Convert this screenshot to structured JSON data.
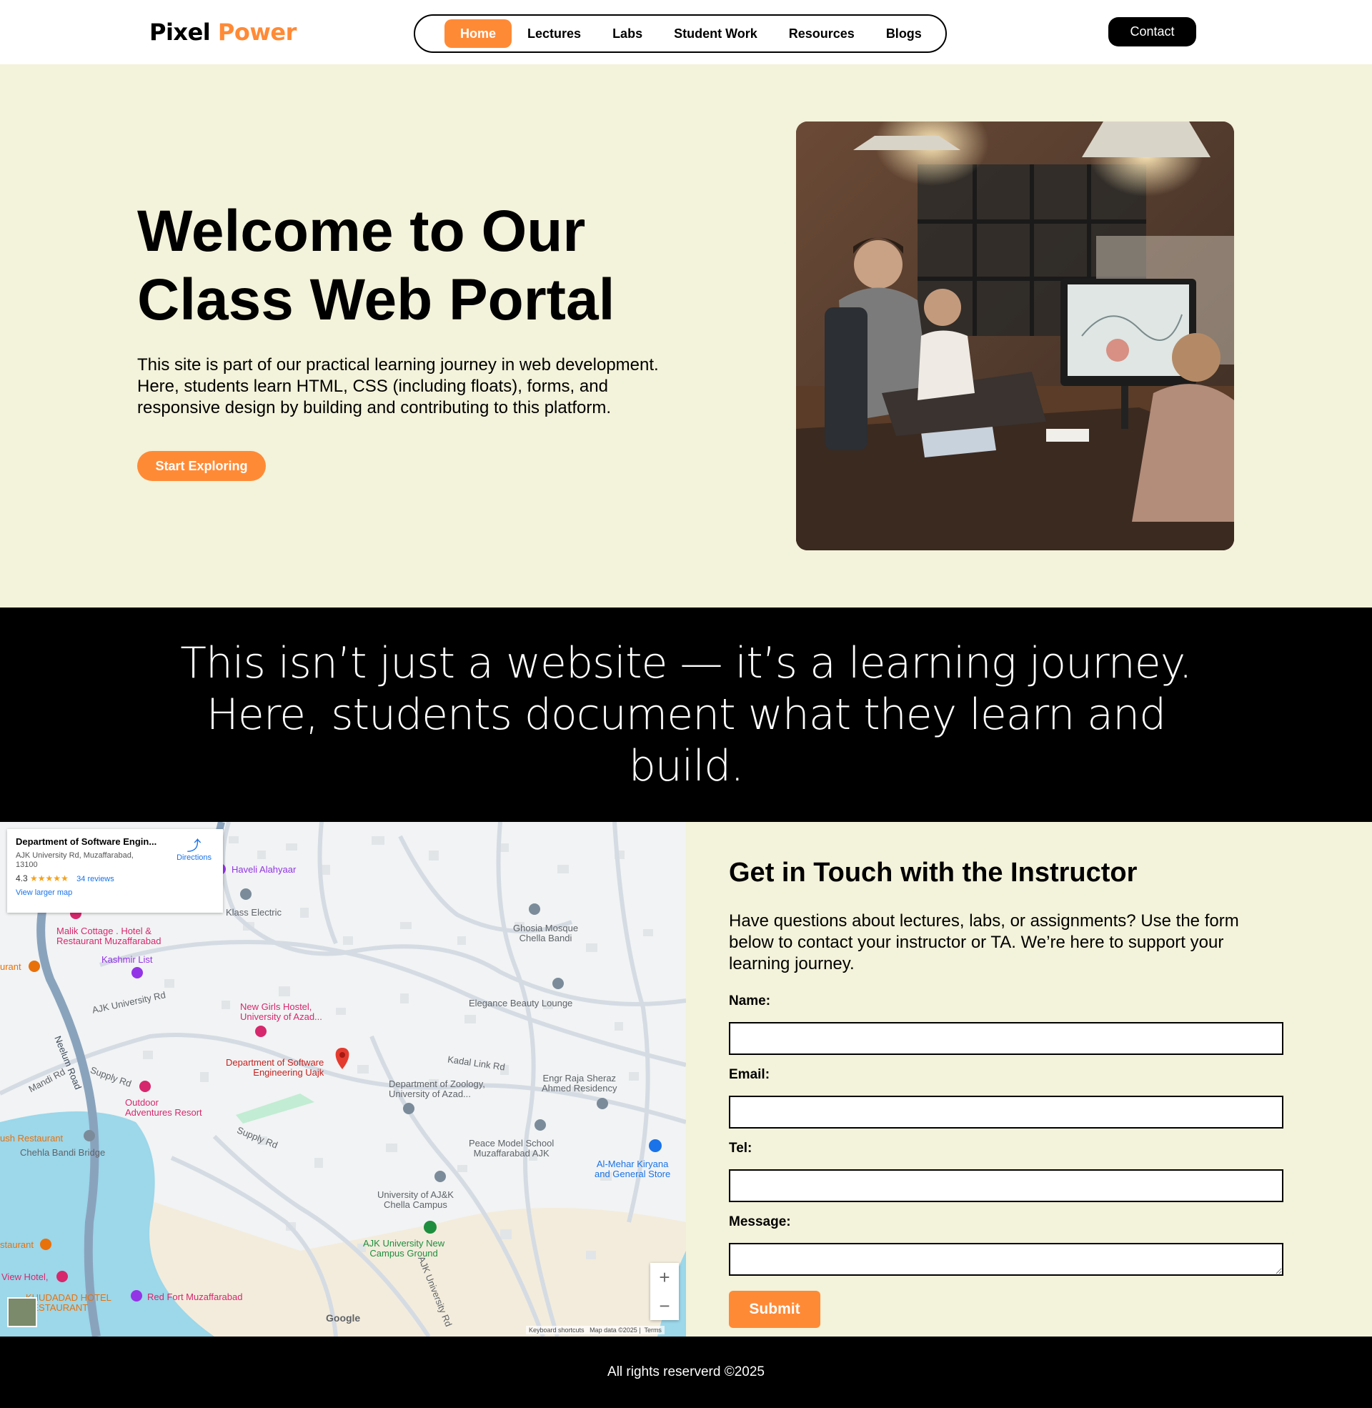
{
  "header": {
    "logo_part1": "Pixel",
    "logo_part2": "Power",
    "nav": [
      "Home",
      "Lectures",
      "Labs",
      "Student Work",
      "Resources",
      "Blogs"
    ],
    "active_nav": "Home",
    "contact_label": "Contact",
    "accent_color": "#ff8a36"
  },
  "hero": {
    "title": "Welcome to Our Class Web Portal",
    "text": "This site is part of our practical learning journey in web development. Here, students learn HTML, CSS (including floats), forms, and responsive design by building and contributing to this platform.",
    "button_label": "Start Exploring",
    "image_icon": "office-classroom-photo"
  },
  "quote": {
    "text": "This isn’t just a website — it’s a learning journey. Here, students document what they learn and build."
  },
  "map": {
    "place_title": "Department of Software Engin...",
    "address": "AJK University Rd, Muzaffarabad, 13100",
    "rating": "4.3",
    "stars": "★★★★★",
    "reviews": "34 reviews",
    "larger_map": "View larger map",
    "directions": "Directions",
    "labels": {
      "haveli": "Haveli Alahyaar",
      "klass": "Klass Electric",
      "ghosia": "Ghosia Mosque\nChella Bandi",
      "malik": "Malik Cottage . Hotel &\nRestaurant Muzaffarabad",
      "kashmir": "Kashmir List",
      "urant": "urant",
      "ajk_rd": "AJK University Rd",
      "elegance": "Elegance Beauty Lounge",
      "newgirls": "New Girls Hostel,\nUniversity of Azad...",
      "neelum": "Neelum Road",
      "mandi": "Mandi Rd",
      "supply1": "Supply Rd",
      "dept_sw": "Department of Software\nEngineering Uajk",
      "kadal": "Kadal Link Rd",
      "zoology": "Department of Zoology,\nUniversity of Azad...",
      "engr": "Engr Raja Sheraz\nAhmed Residency",
      "outdoor": "Outdoor\nAdventures Resort",
      "supply2": "Supply Rd",
      "ush": "ush Restaurant",
      "chehla": "Chehla Bandi Bridge",
      "peace": "Peace Model School\nMuzaffarabad AJK",
      "mehar": "Al-Mehar Kiryana\nand General Store",
      "chella_campus": "University of AJ&K\nChella Campus",
      "staurant": "staurant",
      "ajk_ground": "AJK University New\nCampus Ground",
      "view_hotel": "View Hotel,",
      "khudadad": "KHUDADAD HOTEL\nRESTAURANT",
      "redfort": "Red Fort Muzaffarabad",
      "ajk_rd2": "AJK University Rd"
    },
    "google": "Google",
    "keyboard": "Keyboard shortcuts",
    "mapdata": "Map data ©2025",
    "terms": "Terms",
    "zoom_in": "+",
    "zoom_out": "−"
  },
  "contact": {
    "title": "Get in Touch with the Instructor",
    "intro": "Have questions about lectures, labs, or assignments? Use the form below to contact your instructor or TA. We’re here to support your learning journey.",
    "labels": {
      "name": "Name:",
      "email": "Email:",
      "tel": "Tel:",
      "message": "Message:"
    },
    "values": {
      "name": "",
      "email": "",
      "tel": "",
      "message": ""
    },
    "submit_label": "Submit"
  },
  "footer": {
    "text": "All rights reserverd ©2025"
  }
}
